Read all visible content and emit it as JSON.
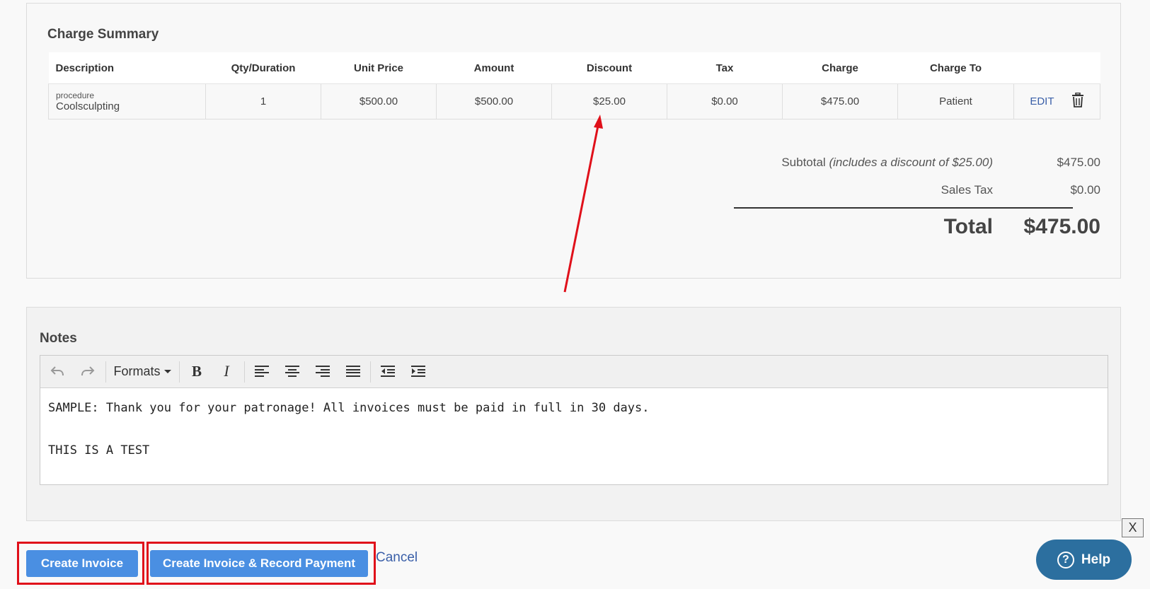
{
  "charge_summary": {
    "title": "Charge Summary",
    "columns": [
      "Description",
      "Qty/Duration",
      "Unit Price",
      "Amount",
      "Discount",
      "Tax",
      "Charge",
      "Charge To"
    ],
    "rows": [
      {
        "type": "procedure",
        "name": "Coolsculpting",
        "qty": "1",
        "unit_price": "$500.00",
        "amount": "$500.00",
        "discount": "$25.00",
        "tax": "$0.00",
        "charge": "$475.00",
        "charge_to": "Patient",
        "edit_label": "EDIT"
      }
    ],
    "totals": {
      "subtotal_label": "Subtotal",
      "subtotal_note": "(includes a discount of $25.00)",
      "subtotal_value": "$475.00",
      "sales_tax_label": "Sales Tax",
      "sales_tax_value": "$0.00",
      "total_label": "Total",
      "total_value": "$475.00"
    }
  },
  "notes": {
    "title": "Notes",
    "toolbar": {
      "formats_label": "Formats",
      "icons": [
        "undo-icon",
        "redo-icon",
        "bold-icon",
        "italic-icon",
        "align-left-icon",
        "align-center-icon",
        "align-right-icon",
        "align-justify-icon",
        "outdent-icon",
        "indent-icon"
      ]
    },
    "lines": [
      "SAMPLE: Thank you for your patronage! All invoices must be paid in full in 30 days.",
      "THIS IS A TEST"
    ]
  },
  "footer": {
    "create_invoice_label": "Create Invoice",
    "create_and_pay_label": "Create Invoice & Record Payment",
    "cancel_label": "Cancel",
    "close_label": "X",
    "help_label": "Help"
  },
  "colors": {
    "primary_button": "#4a8fe2",
    "link": "#3a5fa8",
    "help_button": "#2c6f9f",
    "annotation_red": "#e0101a"
  }
}
